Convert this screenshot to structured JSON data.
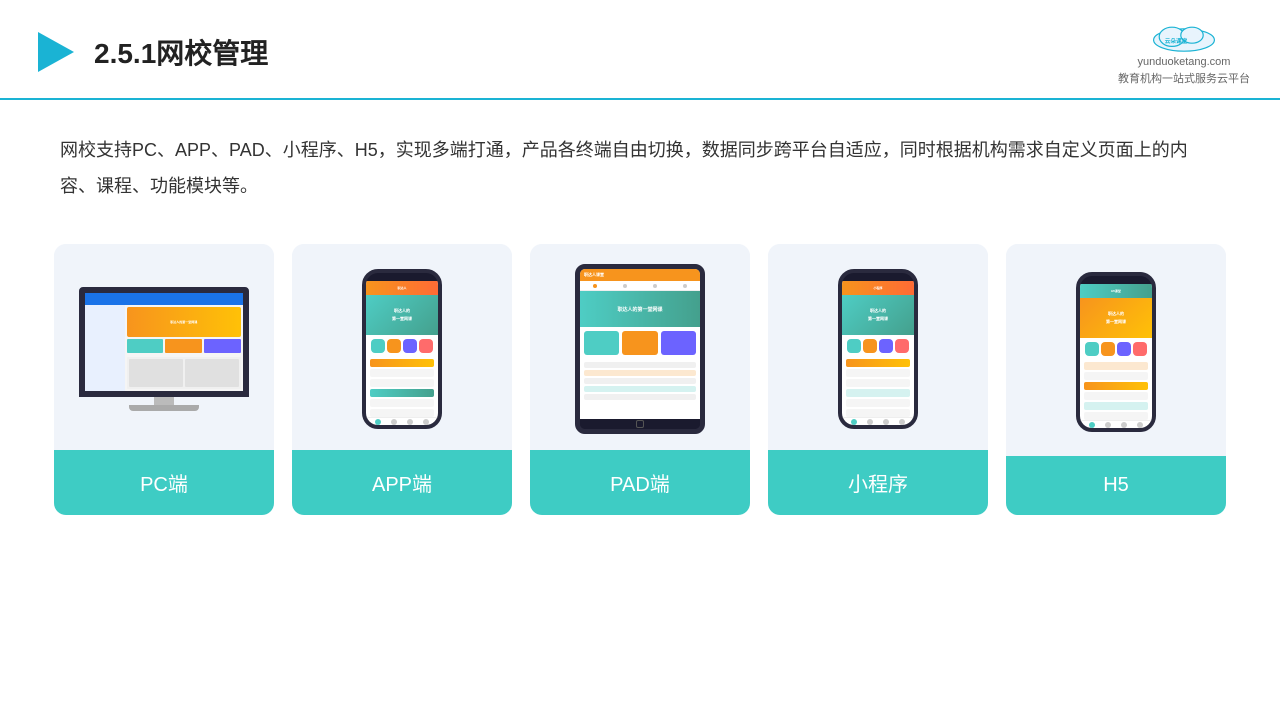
{
  "header": {
    "title": "2.5.1网校管理",
    "logo_url": "yunduoketang.com",
    "logo_tagline": "教育机构一站式服务云平台"
  },
  "description": {
    "text": "网校支持PC、APP、PAD、小程序、H5，实现多端打通，产品各终端自由切换，数据同步跨平台自适应，同时根据机构需求自定义页面上的内容、课程、功能模块等。"
  },
  "cards": [
    {
      "id": "pc",
      "label": "PC端"
    },
    {
      "id": "app",
      "label": "APP端"
    },
    {
      "id": "pad",
      "label": "PAD端"
    },
    {
      "id": "miniapp",
      "label": "小程序"
    },
    {
      "id": "h5",
      "label": "H5"
    }
  ]
}
